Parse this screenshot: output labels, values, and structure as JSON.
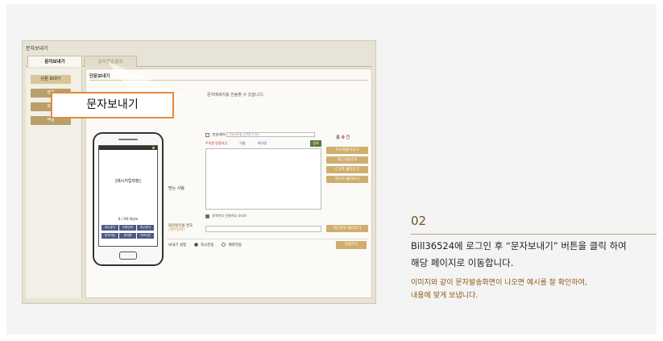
{
  "screenshot": {
    "window_title": "문자보내기",
    "tabs": [
      {
        "label": "문자보내기",
        "active": true
      },
      {
        "label": "문자전송결과",
        "active": false
      }
    ],
    "left_nav": [
      {
        "label": "단문 보내기",
        "selected": true
      },
      {
        "label": "장문",
        "selected": false
      },
      {
        "label": "포고",
        "selected": false
      },
      {
        "label": "엑셀",
        "selected": false
      }
    ],
    "main_tab": "단문보내기",
    "description": "문자메세지를 전송할 수 있습니다.",
    "phone": {
      "message": "[메시지입력창]",
      "bytes": "0 / 90 Byte",
      "buttons": [
        "특수문자",
        "이름입력",
        "특수문자",
        "문자저장",
        "문자함",
        "이모티콘"
      ]
    },
    "compose": {
      "label": "받는 사람",
      "subject_label": "전송제목",
      "subject_placeholder": "전송제목을 입력해 주세요",
      "special_fields": [
        "주의할 받을대상",
        "이름",
        "회사명"
      ],
      "add_button": "등록",
      "count_prefix": "총",
      "count_value": "0",
      "count_suffix": "건",
      "side_buttons": [
        "주소록불러오기",
        "최근사용번호",
        "C.S목 불러오기",
        "엑스트 불러오기"
      ],
      "checkbox_label": "중복번호 전화번호 보내기"
    },
    "recipient": {
      "label_line1": "회신받으실 번호",
      "label_line2": "(필수입력)",
      "button": "최근번호 불러오기"
    },
    "send": {
      "label": "보내기 설정",
      "option_now": "즉시전송",
      "option_reserve": "예약전송",
      "button": "전송하기"
    }
  },
  "callout": {
    "text": "문자보내기",
    "border_color": "#e8883a"
  },
  "step": {
    "number": "02",
    "title_line1": "Bill36524에 로그인 후 “문자보내기” 버튼을 클릭 하여",
    "title_line2": "해당 페이지로 이동합니다.",
    "desc_line1": "이미지와 같이 문자발송화면이 나오면 예시를 잘 확인하여,",
    "desc_line2": "내용에 맞게 보냅니다."
  }
}
